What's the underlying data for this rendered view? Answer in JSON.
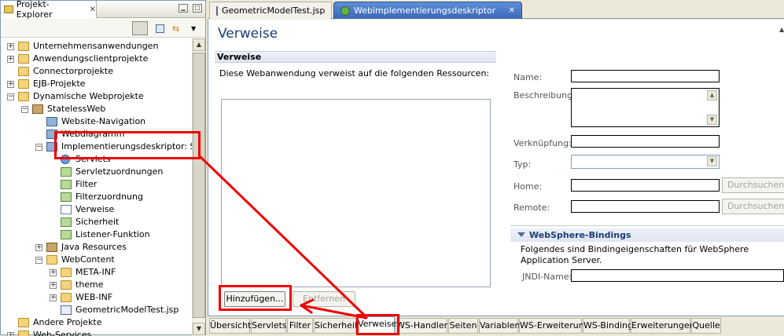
{
  "explorer": {
    "title": "Projekt-Explorer",
    "tree": [
      {
        "label": "Unternehmensanwendungen",
        "indent": 0,
        "expander": "+",
        "icon": "folder-icon"
      },
      {
        "label": "Anwendungsclientprojekte",
        "indent": 0,
        "expander": "+",
        "icon": "folder-icon"
      },
      {
        "label": "Connectorprojekte",
        "indent": 0,
        "expander": "",
        "icon": "folder-icon"
      },
      {
        "label": "EJB-Projekte",
        "indent": 0,
        "expander": "+",
        "icon": "folder-icon"
      },
      {
        "label": "Dynamische Webprojekte",
        "indent": 0,
        "expander": "-",
        "icon": "folder-icon"
      },
      {
        "label": "StatelessWeb",
        "indent": 1,
        "expander": "-",
        "icon": "web-project-icon"
      },
      {
        "label": "Website-Navigation",
        "indent": 2,
        "expander": "",
        "icon": "site-navigation-icon"
      },
      {
        "label": "Webdiagramm",
        "indent": 2,
        "expander": "",
        "icon": "web-diagram-icon"
      },
      {
        "label": "Implementierungsdeskriptor: Stat(",
        "indent": 2,
        "expander": "-",
        "icon": "deployment-descriptor-icon"
      },
      {
        "label": "Servlets",
        "indent": 3,
        "expander": "",
        "icon": "servlets-gear-icon"
      },
      {
        "label": "Servletzuordnungen",
        "indent": 3,
        "expander": "",
        "icon": "servlet-mapping-icon"
      },
      {
        "label": "Filter",
        "indent": 3,
        "expander": "",
        "icon": "filter-icon"
      },
      {
        "label": "Filterzuordnung",
        "indent": 3,
        "expander": "",
        "icon": "filter-mapping-icon"
      },
      {
        "label": "Verweise",
        "indent": 3,
        "expander": "",
        "icon": "references-icon"
      },
      {
        "label": "Sicherheit",
        "indent": 3,
        "expander": "",
        "icon": "security-key-icon"
      },
      {
        "label": "Listener-Funktion",
        "indent": 3,
        "expander": "",
        "icon": "listener-icon"
      },
      {
        "label": "Java Resources",
        "indent": 2,
        "expander": "+",
        "icon": "java-resources-icon"
      },
      {
        "label": "WebContent",
        "indent": 2,
        "expander": "-",
        "icon": "folder-icon"
      },
      {
        "label": "META-INF",
        "indent": 3,
        "expander": "+",
        "icon": "folder-icon"
      },
      {
        "label": "theme",
        "indent": 3,
        "expander": "+",
        "icon": "folder-icon"
      },
      {
        "label": "WEB-INF",
        "indent": 3,
        "expander": "+",
        "icon": "folder-icon"
      },
      {
        "label": "GeometricModelTest.jsp",
        "indent": 3,
        "expander": "",
        "icon": "jsp-file-icon"
      },
      {
        "label": "Andere Projekte",
        "indent": 0,
        "expander": "",
        "icon": "folder-icon"
      },
      {
        "label": "Web-Services",
        "indent": 0,
        "expander": "+",
        "icon": "folder-icon"
      }
    ]
  },
  "editor": {
    "tabs": [
      {
        "label": "GeometricModelTest.jsp",
        "active": false
      },
      {
        "label": "Webimplementierungsdeskriptor",
        "active": true
      }
    ],
    "page_title": "Verweise",
    "section_title": "Verweise",
    "section_description": "Diese Webanwendung verweist auf die folgenden Ressourcen:",
    "add_button": "Hinzufügen...",
    "remove_button": "Entfernen",
    "fields": {
      "name_label": "Name:",
      "description_label": "Beschreibung:",
      "link_label": "Verknüpfung:",
      "type_label": "Typ:",
      "home_label": "Home:",
      "remote_label": "Remote:",
      "browse_label": "Durchsuchen..."
    },
    "websphere": {
      "title": "WebSphere-Bindings",
      "description": "Folgendes sind Bindingeigenschaften für WebSphere Application Server.",
      "jndi_label": "JNDI-Name:"
    },
    "bottom_tabs": [
      "Übersicht",
      "Servlets",
      "Filter",
      "Sicherheit",
      "Verweise",
      "WS-Handler",
      "Seiten",
      "Variablen",
      "WS-Erweiterung",
      "WS-Binding",
      "Erweiterungen",
      "Quelle"
    ],
    "active_bottom_tab": "Verweise"
  },
  "colors": {
    "annotation": "#e00000",
    "active_tab": "#3a68b8",
    "title_text": "#1b3c78"
  }
}
